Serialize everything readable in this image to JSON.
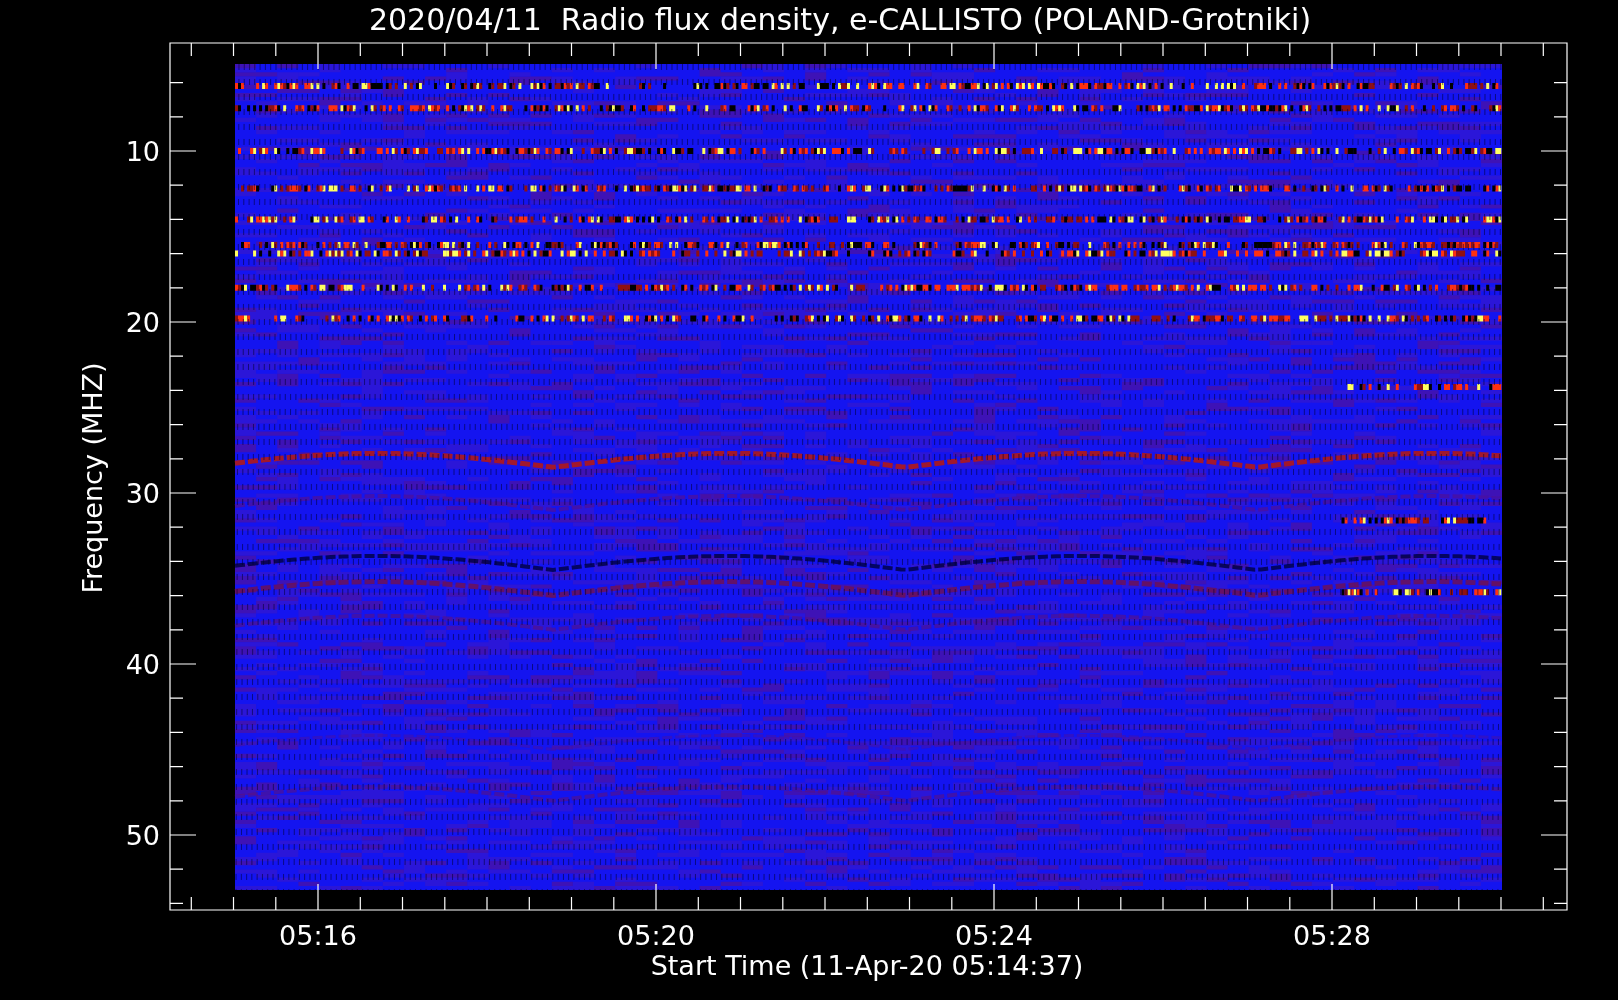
{
  "title": "2020/04/11  Radio flux density, e-CALLISTO (POLAND-Grotniki)",
  "ylabel": "Frequency (MHZ)",
  "xlabel": "Start Time (11-Apr-20 05:14:37)",
  "yticks": [
    "10",
    "20",
    "30",
    "40",
    "50"
  ],
  "xticks": [
    "05:16",
    "05:20",
    "05:24",
    "05:28"
  ]
}
